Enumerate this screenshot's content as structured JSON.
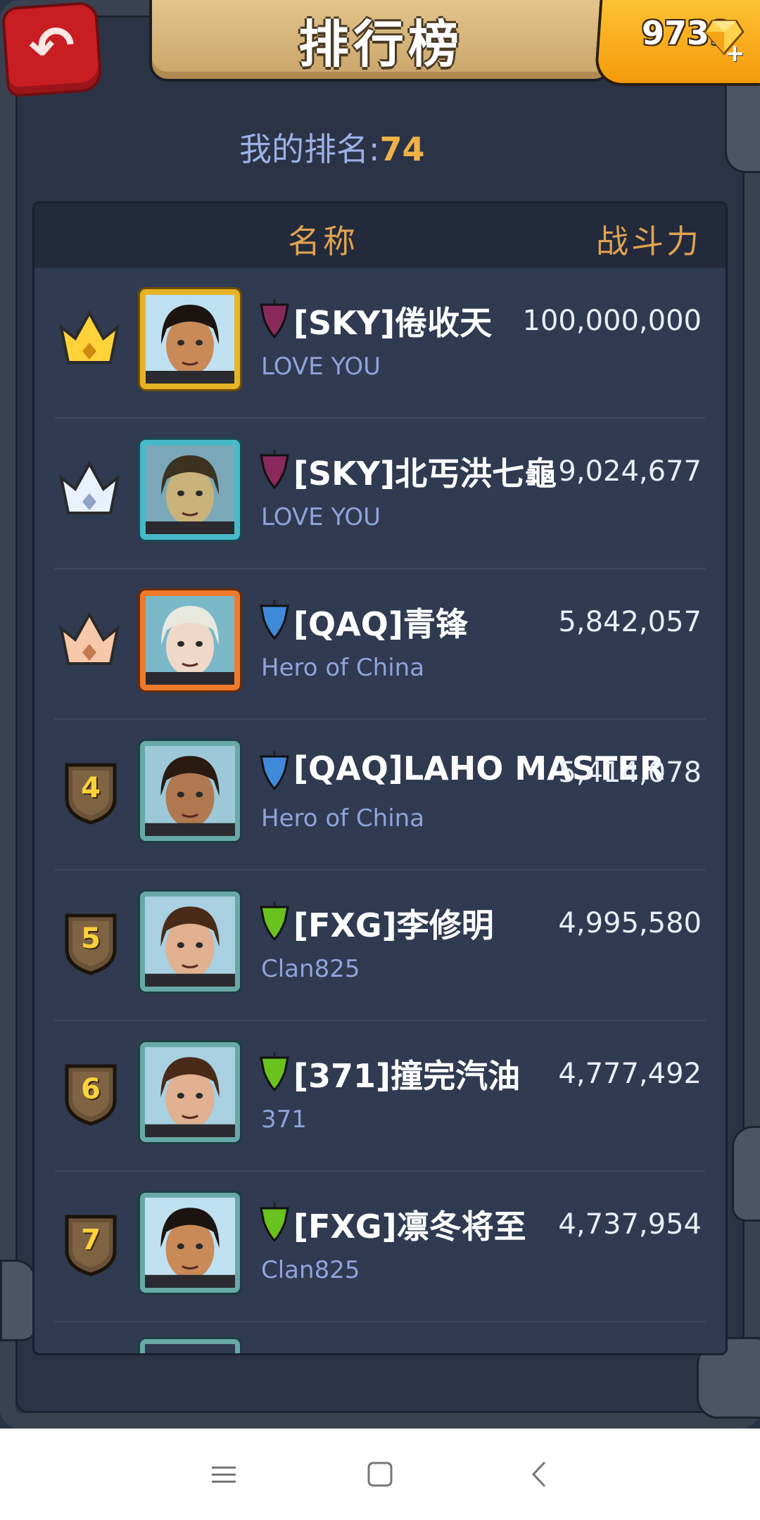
{
  "header": {
    "title": "排行榜",
    "gems": "9739"
  },
  "my_rank": {
    "label": "我的排名:",
    "value": "74"
  },
  "table": {
    "col_name": "名称",
    "col_power": "战斗力"
  },
  "rows": [
    {
      "rank": "1",
      "badge": "crown-gold",
      "avatar_frame": "gold",
      "banner_color": "#8a2a5c",
      "name": "[SKY]倦收天",
      "clan": "LOVE YOU",
      "power": "100,000,000"
    },
    {
      "rank": "2",
      "badge": "crown-silver",
      "avatar_frame": "cyan",
      "banner_color": "#8a2a5c",
      "name": "[SKY]北丐洪七龜",
      "clan": "LOVE YOU",
      "power": "9,024,677"
    },
    {
      "rank": "3",
      "badge": "crown-bronze",
      "avatar_frame": "orange",
      "banner_color": "#3f8ad8",
      "name": "[QAQ]青锋",
      "clan": "Hero of China",
      "power": "5,842,057"
    },
    {
      "rank": "4",
      "badge": "shield",
      "avatar_frame": "teal",
      "banner_color": "#3f8ad8",
      "name": "[QAQ]LAHO MASTER",
      "clan": "Hero of China",
      "power": "5,414,078"
    },
    {
      "rank": "5",
      "badge": "shield",
      "avatar_frame": "teal",
      "banner_color": "#6ac21e",
      "name": "[FXG]李修明",
      "clan": "Clan825",
      "power": "4,995,580"
    },
    {
      "rank": "6",
      "badge": "shield",
      "avatar_frame": "teal",
      "banner_color": "#6ac21e",
      "name": "[371]撞完汽油",
      "clan": "371",
      "power": "4,777,492"
    },
    {
      "rank": "7",
      "badge": "shield",
      "avatar_frame": "teal",
      "banner_color": "#6ac21e",
      "name": "[FXG]凛冬将至",
      "clan": "Clan825",
      "power": "4,737,954"
    }
  ],
  "colors": {
    "background": "#2b3447",
    "panel": "#303a51",
    "header_text": "#e0a250",
    "rank_value": "#f0b248",
    "clan_text": "#8fa4db"
  },
  "navbar": {
    "menu_icon": "menu-icon",
    "home_icon": "home-square-icon",
    "back_icon": "back-chevron-icon"
  }
}
